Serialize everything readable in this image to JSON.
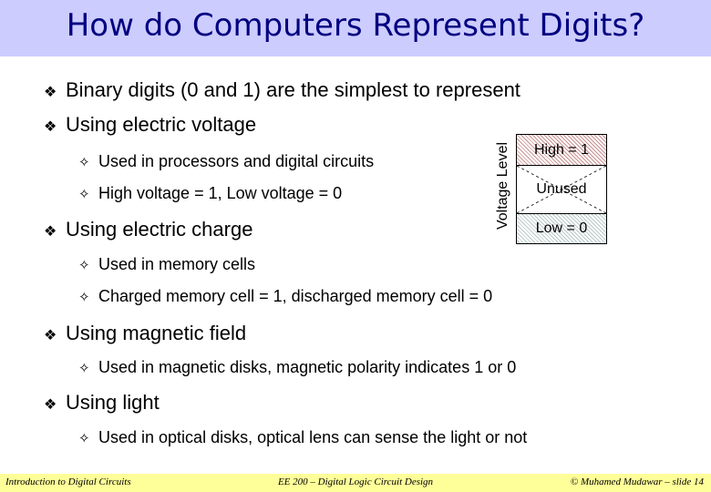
{
  "title": "How do Computers Represent Digits?",
  "bullets": {
    "b1": "Binary digits (0 and 1) are the simplest to represent",
    "b2": "Using electric voltage",
    "b2_1": "Used in processors and digital circuits",
    "b2_2": "High voltage = 1, Low voltage = 0",
    "b3": "Using electric charge",
    "b3_1": "Used in memory cells",
    "b3_2": "Charged memory cell = 1, discharged memory cell = 0",
    "b4": "Using magnetic field",
    "b4_1": "Used in magnetic disks, magnetic polarity indicates 1 or 0",
    "b5": "Using light",
    "b5_1": "Used in optical disks, optical lens can sense the light or not"
  },
  "glyphs": {
    "level1": "❖",
    "level2": "✧"
  },
  "diagram": {
    "axis_label": "Voltage Level",
    "high": "High = 1",
    "unused": "Unused",
    "low": "Low = 0"
  },
  "footer": {
    "left": "Introduction to Digital Circuits",
    "center": "EE 200 – Digital Logic Circuit Design",
    "right": "© Muhamed Mudawar – slide 14"
  }
}
